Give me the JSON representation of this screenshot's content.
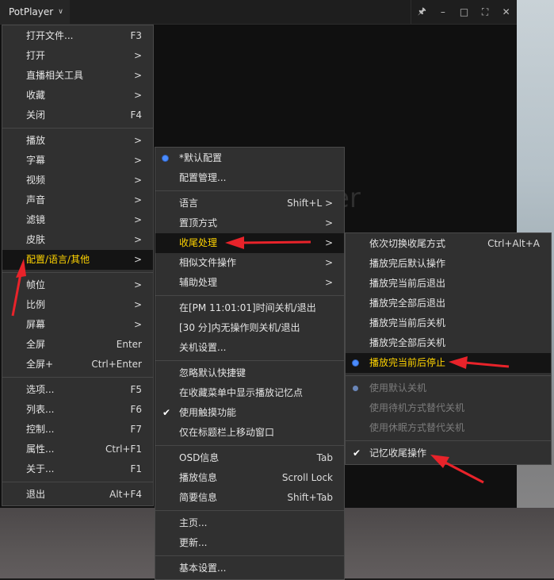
{
  "app": {
    "title": "PotPlayer"
  },
  "window_controls": [
    "pin-icon",
    "minimize-icon",
    "restore-icon",
    "maximize-icon",
    "close-icon"
  ],
  "main_menu": {
    "items": [
      {
        "label": "打开文件...",
        "shortcut": "F3"
      },
      {
        "label": "打开",
        "shortcut": ">"
      },
      {
        "label": "直播相关工具",
        "shortcut": ">"
      },
      {
        "label": "收藏",
        "shortcut": ">"
      },
      {
        "label": "关闭",
        "shortcut": "F4"
      },
      {
        "label": "播放",
        "shortcut": ">"
      },
      {
        "label": "字幕",
        "shortcut": ">"
      },
      {
        "label": "视频",
        "shortcut": ">"
      },
      {
        "label": "声音",
        "shortcut": ">"
      },
      {
        "label": "滤镜",
        "shortcut": ">"
      },
      {
        "label": "皮肤",
        "shortcut": ">"
      },
      {
        "label": "配置/语言/其他",
        "shortcut": ">"
      },
      {
        "label": "帧位",
        "shortcut": ">"
      },
      {
        "label": "比例",
        "shortcut": ">"
      },
      {
        "label": "屏幕",
        "shortcut": ">"
      },
      {
        "label": "全屏",
        "shortcut": "Enter"
      },
      {
        "label": "全屏+",
        "shortcut": "Ctrl+Enter"
      },
      {
        "label": "选项...",
        "shortcut": "F5"
      },
      {
        "label": "列表...",
        "shortcut": "F6"
      },
      {
        "label": "控制...",
        "shortcut": "F7"
      },
      {
        "label": "属性...",
        "shortcut": "Ctrl+F1"
      },
      {
        "label": "关于...",
        "shortcut": "F1"
      },
      {
        "label": "退出",
        "shortcut": "Alt+F4"
      }
    ]
  },
  "config_menu": {
    "items": [
      {
        "label": "*默认配置",
        "shortcut": ""
      },
      {
        "label": "配置管理...",
        "shortcut": ""
      },
      {
        "label": "语言",
        "shortcut": "Shift+L >"
      },
      {
        "label": "置顶方式",
        "shortcut": ">"
      },
      {
        "label": "收尾处理",
        "shortcut": ">"
      },
      {
        "label": "相似文件操作",
        "shortcut": ">"
      },
      {
        "label": "辅助处理",
        "shortcut": ">"
      },
      {
        "label": "在[PM 11:01:01]时间关机/退出",
        "shortcut": ""
      },
      {
        "label": "[30 分]内无操作则关机/退出",
        "shortcut": ""
      },
      {
        "label": "关机设置...",
        "shortcut": ""
      },
      {
        "label": "忽略默认快捷键",
        "shortcut": ""
      },
      {
        "label": "在收藏菜单中显示播放记忆点",
        "shortcut": ""
      },
      {
        "label": "使用触摸功能",
        "shortcut": ""
      },
      {
        "label": "仅在标题栏上移动窗口",
        "shortcut": ""
      },
      {
        "label": "OSD信息",
        "shortcut": "Tab"
      },
      {
        "label": "播放信息",
        "shortcut": "Scroll Lock"
      },
      {
        "label": "简要信息",
        "shortcut": "Shift+Tab"
      },
      {
        "label": "主页...",
        "shortcut": ""
      },
      {
        "label": "更新...",
        "shortcut": ""
      },
      {
        "label": "基本设置...",
        "shortcut": ""
      }
    ]
  },
  "end_menu": {
    "items": [
      {
        "label": "依次切换收尾方式",
        "shortcut": "Ctrl+Alt+A"
      },
      {
        "label": "播放完后默认操作",
        "shortcut": ""
      },
      {
        "label": "播放完当前后退出",
        "shortcut": ""
      },
      {
        "label": "播放完全部后退出",
        "shortcut": ""
      },
      {
        "label": "播放完当前后关机",
        "shortcut": ""
      },
      {
        "label": "播放完全部后关机",
        "shortcut": ""
      },
      {
        "label": "播放完当前后停止",
        "shortcut": ""
      },
      {
        "label": "使用默认关机",
        "shortcut": ""
      },
      {
        "label": "使用待机方式替代关机",
        "shortcut": ""
      },
      {
        "label": "使用休眠方式替代关机",
        "shortcut": ""
      },
      {
        "label": "记忆收尾操作",
        "shortcut": ""
      }
    ]
  },
  "colors": {
    "highlight_text": "#ffd400",
    "annotation_red": "#e8232a",
    "radio_blue": "#4a8cff"
  }
}
